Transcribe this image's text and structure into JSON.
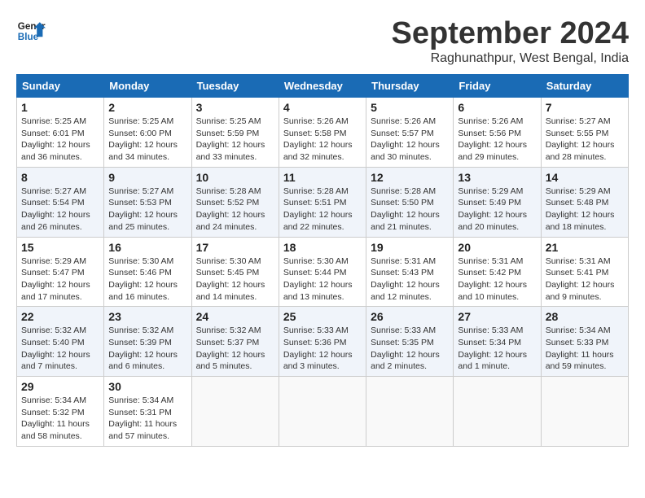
{
  "header": {
    "logo_line1": "General",
    "logo_line2": "Blue",
    "month": "September 2024",
    "location": "Raghunathpur, West Bengal, India"
  },
  "columns": [
    "Sunday",
    "Monday",
    "Tuesday",
    "Wednesday",
    "Thursday",
    "Friday",
    "Saturday"
  ],
  "weeks": [
    [
      {
        "day": "1",
        "info": "Sunrise: 5:25 AM\nSunset: 6:01 PM\nDaylight: 12 hours\nand 36 minutes."
      },
      {
        "day": "2",
        "info": "Sunrise: 5:25 AM\nSunset: 6:00 PM\nDaylight: 12 hours\nand 34 minutes."
      },
      {
        "day": "3",
        "info": "Sunrise: 5:25 AM\nSunset: 5:59 PM\nDaylight: 12 hours\nand 33 minutes."
      },
      {
        "day": "4",
        "info": "Sunrise: 5:26 AM\nSunset: 5:58 PM\nDaylight: 12 hours\nand 32 minutes."
      },
      {
        "day": "5",
        "info": "Sunrise: 5:26 AM\nSunset: 5:57 PM\nDaylight: 12 hours\nand 30 minutes."
      },
      {
        "day": "6",
        "info": "Sunrise: 5:26 AM\nSunset: 5:56 PM\nDaylight: 12 hours\nand 29 minutes."
      },
      {
        "day": "7",
        "info": "Sunrise: 5:27 AM\nSunset: 5:55 PM\nDaylight: 12 hours\nand 28 minutes."
      }
    ],
    [
      {
        "day": "8",
        "info": "Sunrise: 5:27 AM\nSunset: 5:54 PM\nDaylight: 12 hours\nand 26 minutes."
      },
      {
        "day": "9",
        "info": "Sunrise: 5:27 AM\nSunset: 5:53 PM\nDaylight: 12 hours\nand 25 minutes."
      },
      {
        "day": "10",
        "info": "Sunrise: 5:28 AM\nSunset: 5:52 PM\nDaylight: 12 hours\nand 24 minutes."
      },
      {
        "day": "11",
        "info": "Sunrise: 5:28 AM\nSunset: 5:51 PM\nDaylight: 12 hours\nand 22 minutes."
      },
      {
        "day": "12",
        "info": "Sunrise: 5:28 AM\nSunset: 5:50 PM\nDaylight: 12 hours\nand 21 minutes."
      },
      {
        "day": "13",
        "info": "Sunrise: 5:29 AM\nSunset: 5:49 PM\nDaylight: 12 hours\nand 20 minutes."
      },
      {
        "day": "14",
        "info": "Sunrise: 5:29 AM\nSunset: 5:48 PM\nDaylight: 12 hours\nand 18 minutes."
      }
    ],
    [
      {
        "day": "15",
        "info": "Sunrise: 5:29 AM\nSunset: 5:47 PM\nDaylight: 12 hours\nand 17 minutes."
      },
      {
        "day": "16",
        "info": "Sunrise: 5:30 AM\nSunset: 5:46 PM\nDaylight: 12 hours\nand 16 minutes."
      },
      {
        "day": "17",
        "info": "Sunrise: 5:30 AM\nSunset: 5:45 PM\nDaylight: 12 hours\nand 14 minutes."
      },
      {
        "day": "18",
        "info": "Sunrise: 5:30 AM\nSunset: 5:44 PM\nDaylight: 12 hours\nand 13 minutes."
      },
      {
        "day": "19",
        "info": "Sunrise: 5:31 AM\nSunset: 5:43 PM\nDaylight: 12 hours\nand 12 minutes."
      },
      {
        "day": "20",
        "info": "Sunrise: 5:31 AM\nSunset: 5:42 PM\nDaylight: 12 hours\nand 10 minutes."
      },
      {
        "day": "21",
        "info": "Sunrise: 5:31 AM\nSunset: 5:41 PM\nDaylight: 12 hours\nand 9 minutes."
      }
    ],
    [
      {
        "day": "22",
        "info": "Sunrise: 5:32 AM\nSunset: 5:40 PM\nDaylight: 12 hours\nand 7 minutes."
      },
      {
        "day": "23",
        "info": "Sunrise: 5:32 AM\nSunset: 5:39 PM\nDaylight: 12 hours\nand 6 minutes."
      },
      {
        "day": "24",
        "info": "Sunrise: 5:32 AM\nSunset: 5:37 PM\nDaylight: 12 hours\nand 5 minutes."
      },
      {
        "day": "25",
        "info": "Sunrise: 5:33 AM\nSunset: 5:36 PM\nDaylight: 12 hours\nand 3 minutes."
      },
      {
        "day": "26",
        "info": "Sunrise: 5:33 AM\nSunset: 5:35 PM\nDaylight: 12 hours\nand 2 minutes."
      },
      {
        "day": "27",
        "info": "Sunrise: 5:33 AM\nSunset: 5:34 PM\nDaylight: 12 hours\nand 1 minute."
      },
      {
        "day": "28",
        "info": "Sunrise: 5:34 AM\nSunset: 5:33 PM\nDaylight: 11 hours\nand 59 minutes."
      }
    ],
    [
      {
        "day": "29",
        "info": "Sunrise: 5:34 AM\nSunset: 5:32 PM\nDaylight: 11 hours\nand 58 minutes."
      },
      {
        "day": "30",
        "info": "Sunrise: 5:34 AM\nSunset: 5:31 PM\nDaylight: 11 hours\nand 57 minutes."
      },
      {
        "day": "",
        "info": ""
      },
      {
        "day": "",
        "info": ""
      },
      {
        "day": "",
        "info": ""
      },
      {
        "day": "",
        "info": ""
      },
      {
        "day": "",
        "info": ""
      }
    ]
  ]
}
